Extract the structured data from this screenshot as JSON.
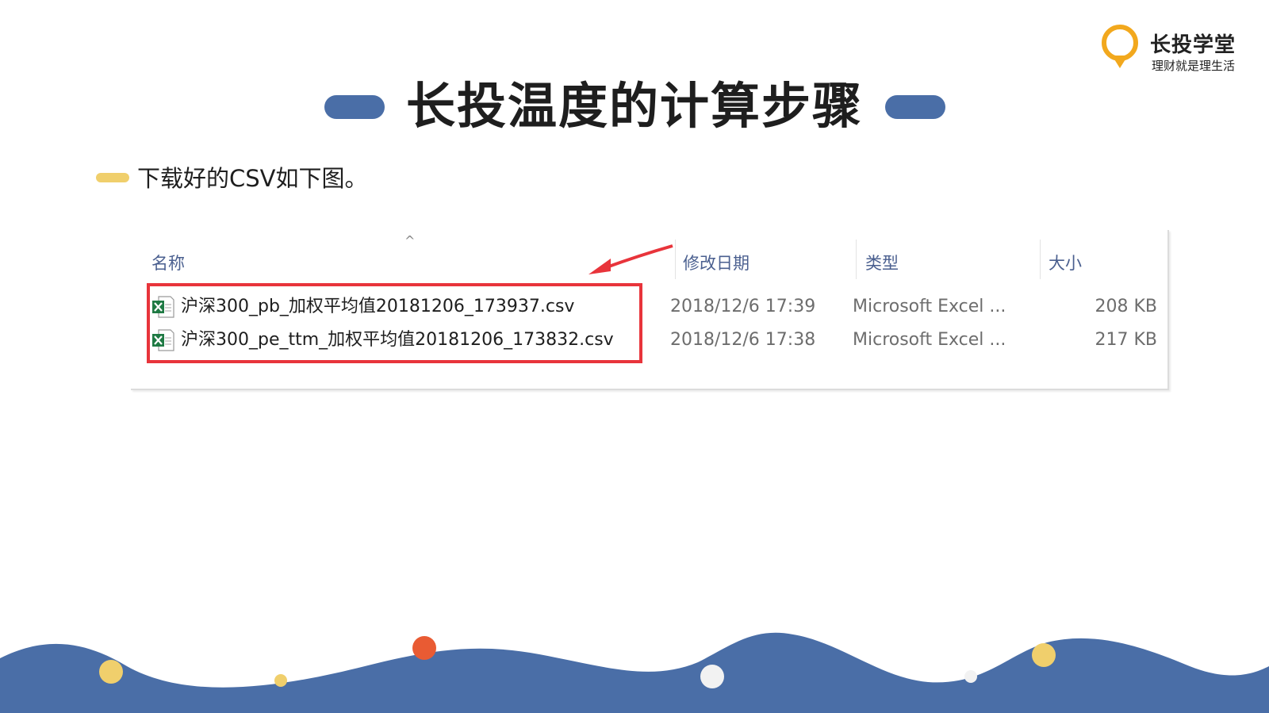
{
  "brand": {
    "name": "长投学堂",
    "slogan": "理财就是理生活",
    "accent_color": "#f2a81d"
  },
  "slide": {
    "title": "长投温度的计算步骤",
    "bullet": "下载好的CSV如下图。",
    "pill_color": "#4a6ea7",
    "bullet_color": "#f0cf6c"
  },
  "explorer": {
    "sort_indicator": "^",
    "columns": {
      "name": "名称",
      "modified": "修改日期",
      "type": "类型",
      "size": "大小"
    },
    "files": [
      {
        "icon": "excel-csv-icon",
        "name": "沪深300_pb_加权平均值20181206_173937.csv",
        "modified": "2018/12/6 17:39",
        "type": "Microsoft Excel ...",
        "size": "208 KB"
      },
      {
        "icon": "excel-csv-icon",
        "name": "沪深300_pe_ttm_加权平均值20181206_173832.csv",
        "modified": "2018/12/6 17:38",
        "type": "Microsoft Excel ...",
        "size": "217 KB"
      }
    ],
    "highlight_color": "#e8343b"
  },
  "footer": {
    "wave_color": "#4a6ea7",
    "dot_colors": [
      "#f0cf6c",
      "#e95b33",
      "#f2f2f2"
    ]
  }
}
